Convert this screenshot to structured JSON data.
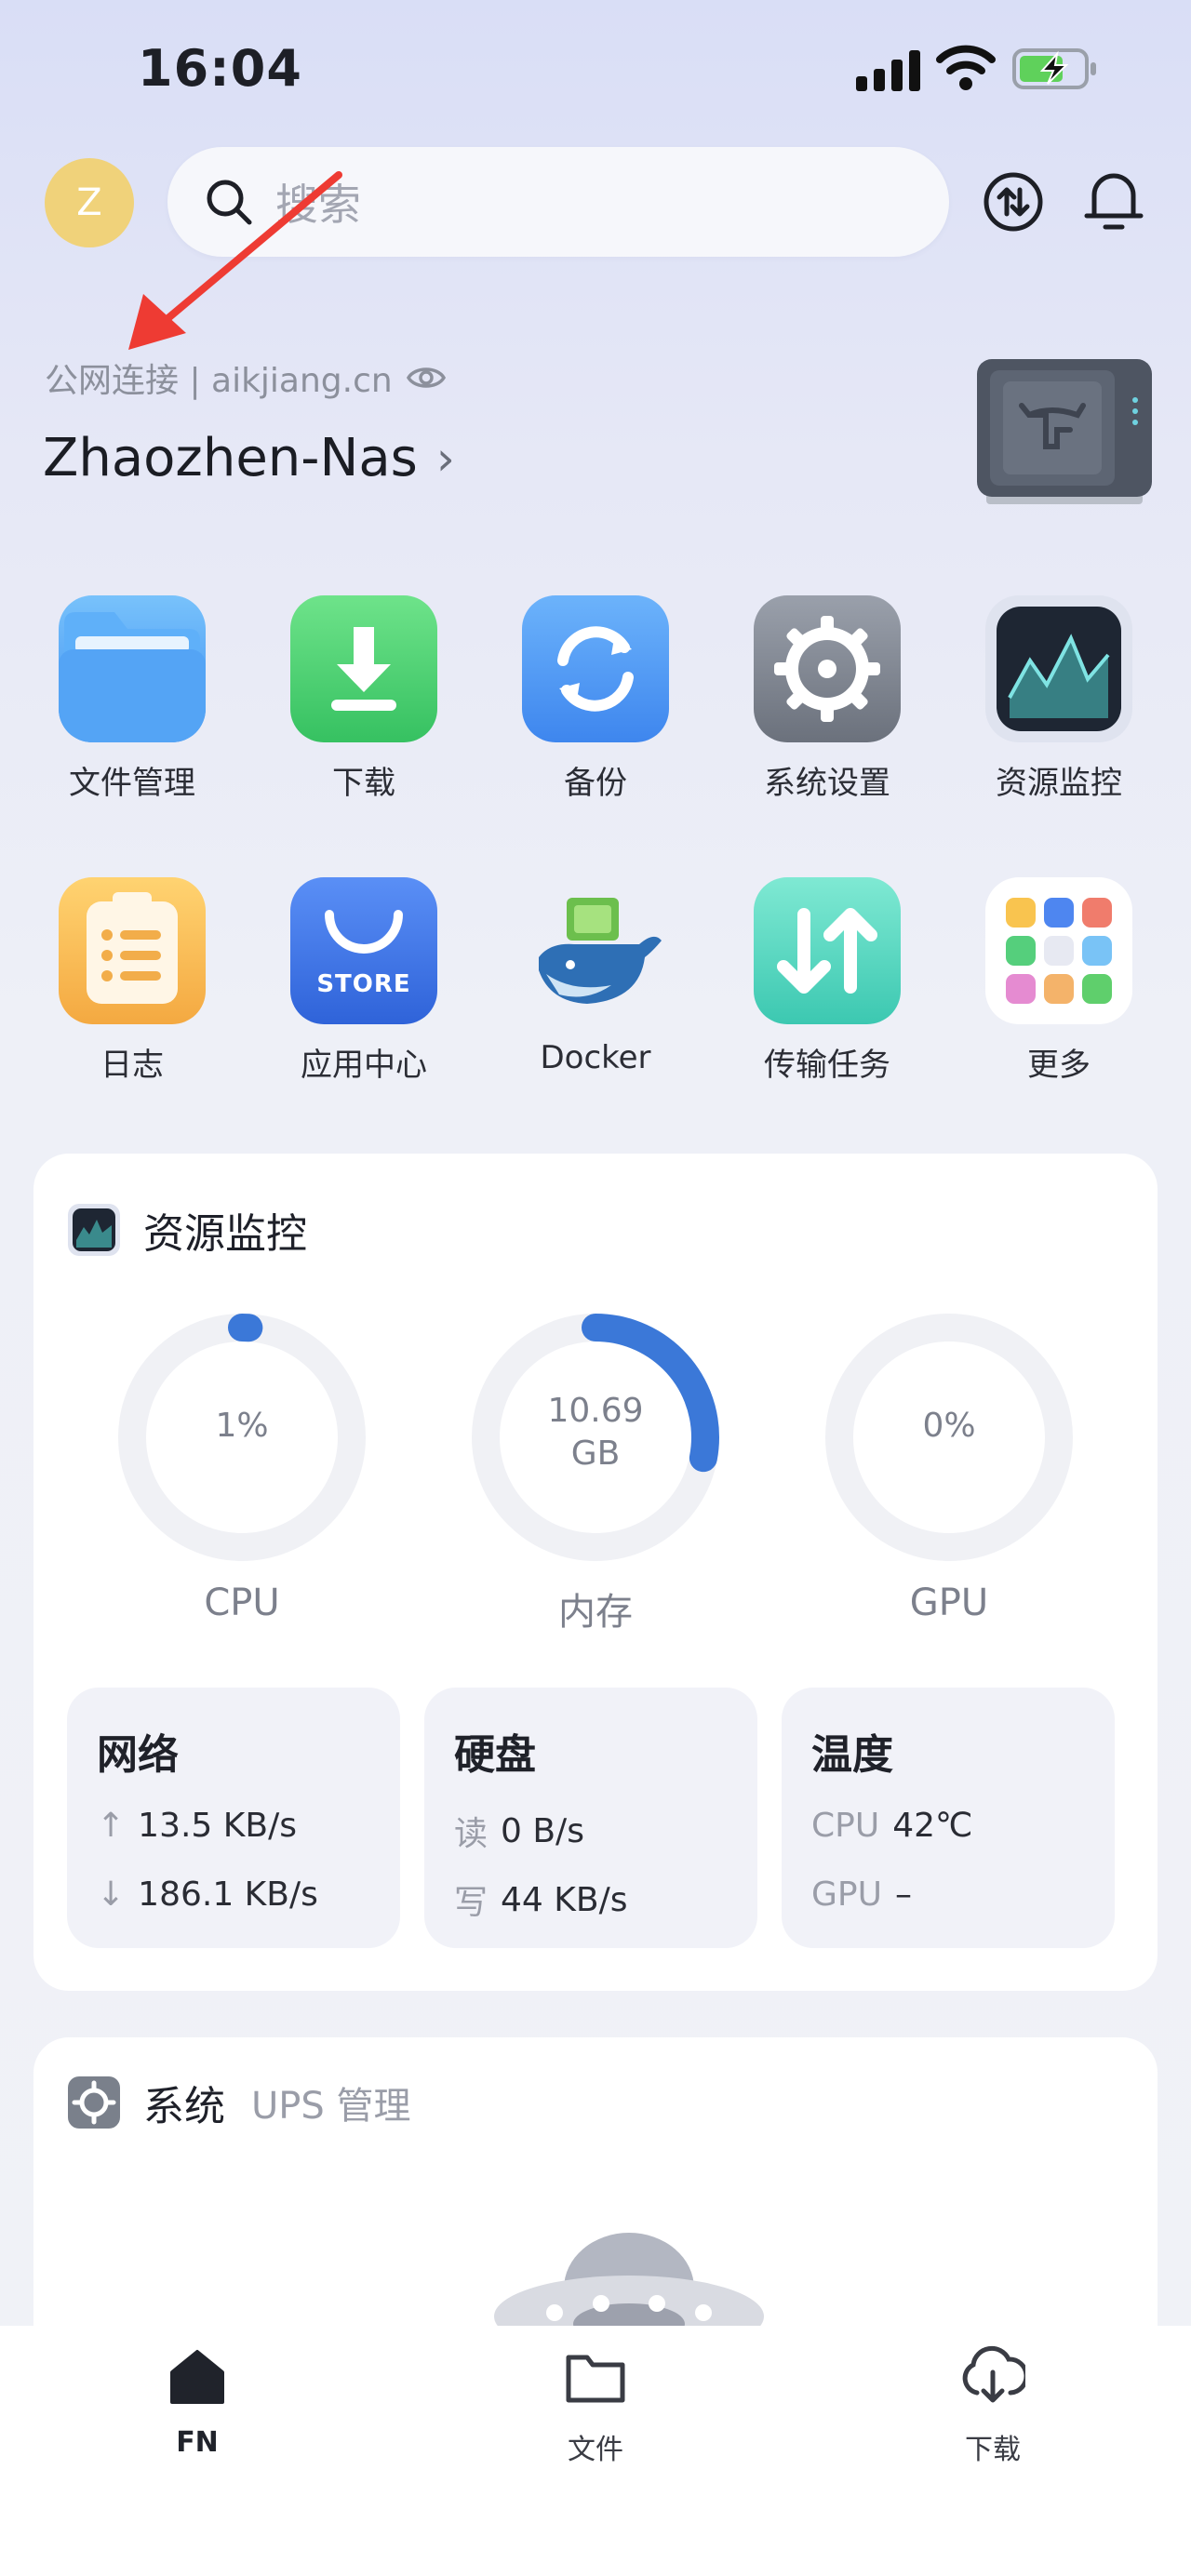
{
  "status_bar": {
    "time": "16:04"
  },
  "header": {
    "avatar_letter": "Z",
    "search_placeholder": "搜索",
    "transfer_icon": "transfer-icon",
    "bell_icon": "bell-icon"
  },
  "device": {
    "connection": "公网连接 | aikjiang.cn",
    "name": "Zhaozhen-Nas",
    "chevron": "›"
  },
  "apps": [
    {
      "label": "文件管理",
      "icon": "folder-icon"
    },
    {
      "label": "下载",
      "icon": "download-icon"
    },
    {
      "label": "备份",
      "icon": "backup-icon"
    },
    {
      "label": "系统设置",
      "icon": "gear-icon"
    },
    {
      "label": "资源监控",
      "icon": "monitor-icon"
    },
    {
      "label": "日志",
      "icon": "log-icon"
    },
    {
      "label": "应用中心",
      "icon": "store-icon",
      "icon_text": "STORE"
    },
    {
      "label": "Docker",
      "icon": "docker-icon"
    },
    {
      "label": "传输任务",
      "icon": "transfer-task-icon"
    },
    {
      "label": "更多",
      "icon": "more-icon"
    }
  ],
  "monitor": {
    "title": "资源监控",
    "gauges": [
      {
        "name": "CPU",
        "value_line1": "1%",
        "value_line2": "",
        "percent": 1
      },
      {
        "name": "内存",
        "value_line1": "10.69",
        "value_line2": "GB",
        "percent": 28
      },
      {
        "name": "GPU",
        "value_line1": "0%",
        "value_line2": "",
        "percent": 0
      }
    ],
    "network": {
      "title": "网络",
      "up": "13.5 KB/s",
      "down": "186.1 KB/s",
      "up_arrow": "↑",
      "down_arrow": "↓"
    },
    "disk": {
      "title": "硬盘",
      "read_label": "读",
      "read": "0 B/s",
      "write_label": "写",
      "write": "44 KB/s"
    },
    "temp": {
      "title": "温度",
      "cpu_label": "CPU",
      "cpu": "42℃",
      "gpu_label": "GPU",
      "gpu": "–"
    }
  },
  "system": {
    "title": "系统",
    "subtitle": "UPS 管理"
  },
  "tabs": [
    {
      "label": "FN",
      "icon": "home-icon"
    },
    {
      "label": "文件",
      "icon": "folder-tab-icon"
    },
    {
      "label": "下载",
      "icon": "download-tab-icon"
    }
  ],
  "colors": {
    "accent": "#3b78d8",
    "gauge_track": "#f0f1f5"
  }
}
